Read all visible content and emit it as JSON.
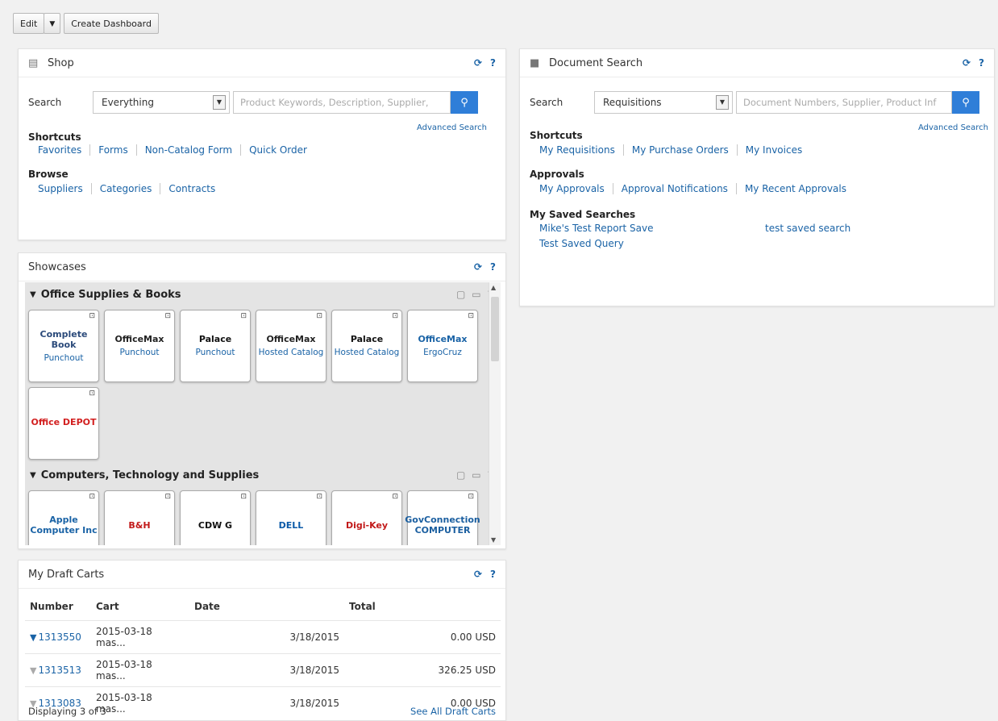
{
  "toolbar": {
    "edit": "Edit",
    "dropdown": "▼",
    "create": "Create Dashboard"
  },
  "shop": {
    "title": "Shop",
    "search_label": "Search",
    "scope": "Everything",
    "placeholder": "Product Keywords, Description, Supplier,",
    "advanced": "Advanced Search",
    "shortcuts_title": "Shortcuts",
    "shortcuts": [
      "Favorites",
      "Forms",
      "Non-Catalog Form",
      "Quick Order"
    ],
    "browse_title": "Browse",
    "browse": [
      "Suppliers",
      "Categories",
      "Contracts"
    ]
  },
  "docsearch": {
    "title": "Document Search",
    "search_label": "Search",
    "scope": "Requisitions",
    "placeholder": "Document Numbers, Supplier, Product Inf",
    "advanced": "Advanced Search",
    "shortcuts_title": "Shortcuts",
    "shortcuts": [
      "My Requisitions",
      "My Purchase Orders",
      "My Invoices"
    ],
    "approvals_title": "Approvals",
    "approvals": [
      "My Approvals",
      "Approval Notifications",
      "My Recent Approvals"
    ],
    "saved_title": "My Saved Searches",
    "saved": [
      "Mike's Test Report Save",
      "test saved search",
      "Test Saved Query"
    ]
  },
  "showcases": {
    "title": "Showcases",
    "categories": [
      {
        "name": "Office Supplies & Books",
        "tiles": [
          {
            "logo": "Complete Book",
            "caption": "Punchout",
            "logo_color": "#2b4a7a"
          },
          {
            "logo": "OfficeMax",
            "caption": "Punchout",
            "logo_color": "#222"
          },
          {
            "logo": "Palace",
            "caption": "Punchout",
            "logo_color": "#111"
          },
          {
            "logo": "OfficeMax",
            "caption": "Hosted Catalog",
            "logo_color": "#222"
          },
          {
            "logo": "Palace",
            "caption": "Hosted Catalog",
            "logo_color": "#111"
          },
          {
            "logo": "OfficeMax",
            "caption": "ErgoCruz",
            "logo_color": "#1a63a6"
          },
          {
            "logo": "Office DEPOT",
            "caption": "",
            "logo_color": "#d21f1f"
          }
        ]
      },
      {
        "name": "Computers, Technology and Supplies",
        "tiles": [
          {
            "logo": "Apple Computer Inc",
            "caption": "",
            "logo_color": "#1a63a6"
          },
          {
            "logo": "B&H",
            "caption": "",
            "logo_color": "#c21a1a"
          },
          {
            "logo": "CDW G",
            "caption": "",
            "logo_color": "#111"
          },
          {
            "logo": "DELL",
            "caption": "",
            "logo_color": "#0b5aa8"
          },
          {
            "logo": "Digi-Key",
            "caption": "",
            "logo_color": "#c21a1a"
          },
          {
            "logo": "GovConnection COMPUTER",
            "caption": "",
            "logo_color": "#1b5fa0"
          }
        ]
      }
    ]
  },
  "carts": {
    "title": "My Draft Carts",
    "headers": [
      "Number",
      "Cart",
      "Date",
      "Total"
    ],
    "rows": [
      {
        "number": "1313550",
        "cart": "2015-03-18 mas...",
        "date": "3/18/2015",
        "total": "0.00 USD",
        "active": true
      },
      {
        "number": "1313513",
        "cart": "2015-03-18 mas...",
        "date": "3/18/2015",
        "total": "326.25 USD",
        "active": false
      },
      {
        "number": "1313083",
        "cart": "2015-03-18 mas...",
        "date": "3/18/2015",
        "total": "0.00 USD",
        "active": false
      }
    ],
    "displaying": "Displaying 3 of 3",
    "see_all": "See All Draft Carts"
  },
  "icons": {
    "refresh": "⟳",
    "help": "?",
    "cart": "🛒",
    "search": "🔍"
  }
}
